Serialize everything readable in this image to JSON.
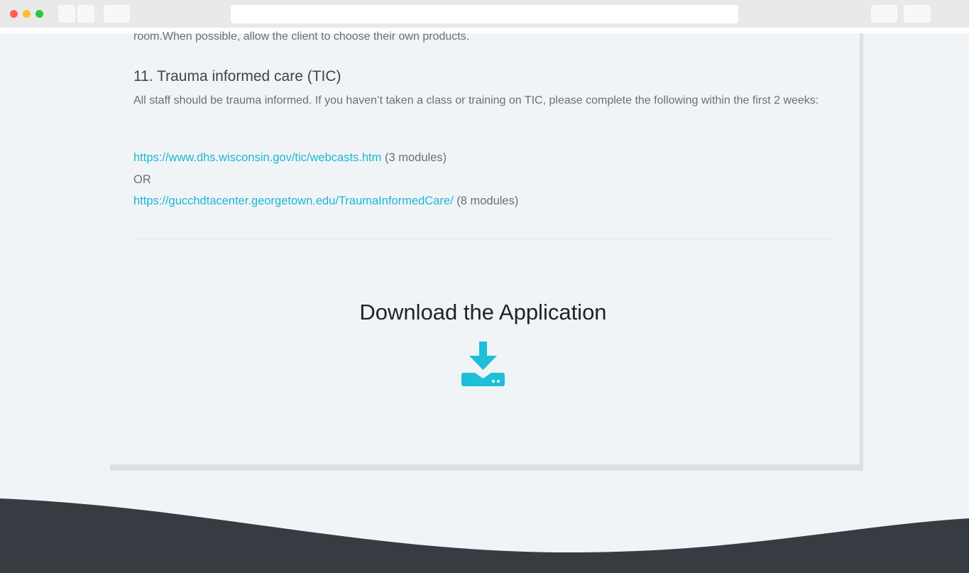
{
  "page": {
    "intro_text": "room.When possible, allow the client to choose their own products.",
    "section": {
      "heading": "11. Trauma informed care (TIC)",
      "body": "All staff should be trauma informed. If you haven’t taken a class or training on TIC, please complete the following within the first 2 weeks:",
      "link1": {
        "text": "https://www.dhs.wisconsin.gov/tic/webcasts.htm",
        "suffix": " (3 modules)"
      },
      "or_text": "OR",
      "link2": {
        "text": "https://gucchdtacenter.georgetown.edu/TraumaInformedCare/",
        "suffix": " (8 modules)"
      }
    },
    "download": {
      "title": "Download the Application",
      "icon": "download-icon"
    }
  },
  "colors": {
    "link": "#1bb8d2",
    "accent": "#1dbfd9",
    "footer": "#373c42",
    "background": "#f1f4f7"
  }
}
